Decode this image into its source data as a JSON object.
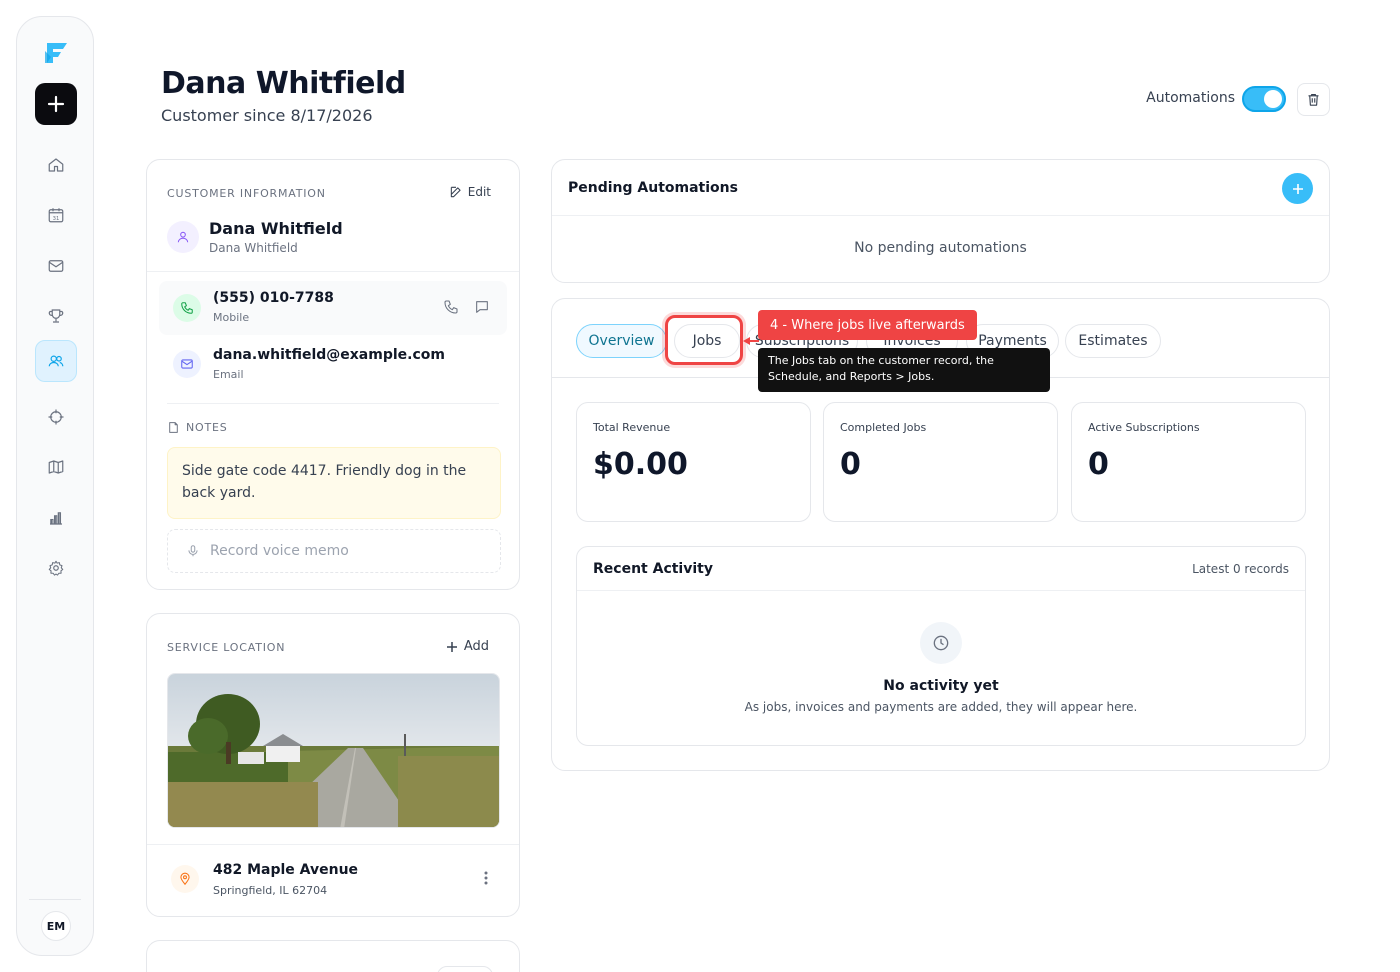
{
  "sidebar": {
    "nav": [
      "home-icon",
      "calendar-icon",
      "mail-icon",
      "trophy-icon",
      "users-icon",
      "target-icon",
      "map-icon",
      "bar-chart-icon",
      "gear-icon"
    ],
    "calendar_day": "31",
    "active": "users-icon",
    "avatar_initials": "EM"
  },
  "header": {
    "title": "Dana Whitfield",
    "subtitle": "Customer since 8/17/2026",
    "automations_label": "Automations",
    "automations_on": true
  },
  "customer_info": {
    "section_label": "CUSTOMER INFORMATION",
    "edit_label": "Edit",
    "name": "Dana Whitfield",
    "name_sub": "Dana Whitfield",
    "phone": "(555) 010-7788",
    "phone_type": "Mobile",
    "email": "dana.whitfield@example.com",
    "email_type": "Email",
    "notes_label": "NOTES",
    "notes": "Side gate code 4417. Friendly dog in the back yard.",
    "voice_memo": "Record voice memo"
  },
  "service_location": {
    "section_label": "SERVICE LOCATION",
    "add_label": "Add",
    "address": "482 Maple Avenue",
    "city": "Springfield, IL 62704"
  },
  "pending_automations": {
    "title": "Pending Automations",
    "empty": "No pending automations"
  },
  "tabs": [
    "Overview",
    "Jobs",
    "Subscriptions",
    "Invoices",
    "Payments",
    "Estimates"
  ],
  "active_tab": "Overview",
  "stats": [
    {
      "label": "Total Revenue",
      "value": "$0.00"
    },
    {
      "label": "Completed Jobs",
      "value": "0"
    },
    {
      "label": "Active Subscriptions",
      "value": "0"
    }
  ],
  "recent_activity": {
    "title": "Recent Activity",
    "meta": "Latest 0 records",
    "empty_title": "No activity yet",
    "empty_sub": "As jobs, invoices and payments are added, they will appear here."
  },
  "callout": {
    "label": "4 - Where jobs live afterwards",
    "tooltip": "The Jobs tab on the customer record, the Schedule, and Reports > Jobs.",
    "color": "#ef4444"
  },
  "colors": {
    "accent": "#38bdf8",
    "callout": "#ef4444"
  }
}
